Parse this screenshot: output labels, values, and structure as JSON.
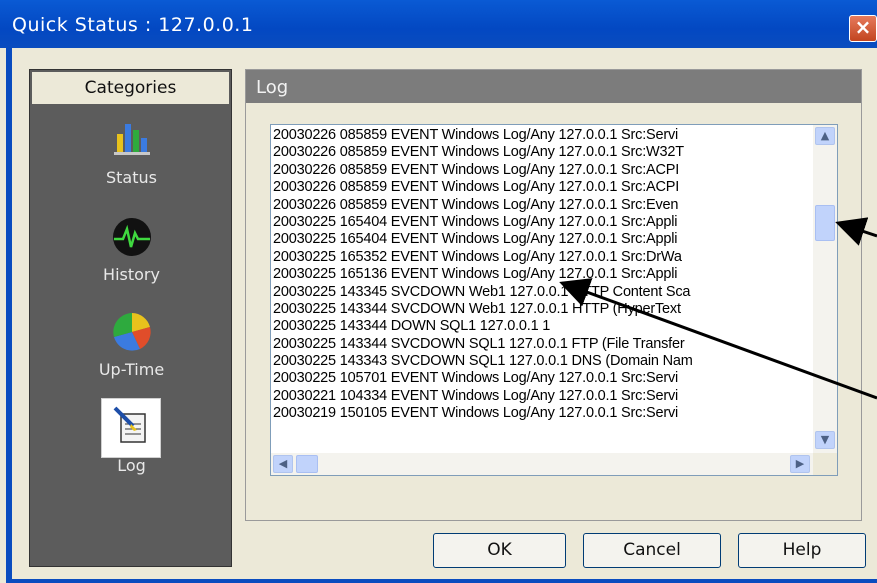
{
  "window": {
    "title": "Quick Status : 127.0.0.1",
    "close_label": "×"
  },
  "categories": {
    "header": "Categories",
    "items": [
      {
        "label": "Status",
        "icon": "bar-chart-icon"
      },
      {
        "label": "History",
        "icon": "heartbeat-icon"
      },
      {
        "label": "Up-Time",
        "icon": "pie-chart-icon"
      },
      {
        "label": "Log",
        "icon": "log-document-icon"
      }
    ]
  },
  "log": {
    "header": "Log",
    "lines": [
      "20030226 085859 EVENT Windows Log/Any 127.0.0.1 Src:Servi",
      "20030226 085859 EVENT Windows Log/Any 127.0.0.1 Src:W32T",
      "20030226 085859 EVENT Windows Log/Any 127.0.0.1 Src:ACPI",
      "20030226 085859 EVENT Windows Log/Any 127.0.0.1 Src:ACPI",
      "20030226 085859 EVENT Windows Log/Any 127.0.0.1 Src:Even",
      "20030225 165404 EVENT Windows Log/Any 127.0.0.1 Src:Appli",
      "20030225 165404 EVENT Windows Log/Any 127.0.0.1 Src:Appli",
      "20030225 165352 EVENT Windows Log/Any 127.0.0.1 Src:DrWa",
      "20030225 165136 EVENT Windows Log/Any 127.0.0.1 Src:Appli",
      "20030225 143345 SVCDOWN Web1 127.0.0.1 HTTP Content Sca",
      "20030225 143344 SVCDOWN Web1 127.0.0.1 HTTP (HyperText",
      "20030225 143344 DOWN SQL1 127.0.0.1 1",
      "20030225 143344 SVCDOWN SQL1 127.0.0.1 FTP (File Transfer",
      "20030225 143343 SVCDOWN SQL1 127.0.0.1 DNS (Domain Nam",
      "20030225 105701 EVENT Windows Log/Any 127.0.0.1 Src:Servi",
      "20030221 104334 EVENT Windows Log/Any 127.0.0.1 Src:Servi",
      "20030219 150105 EVENT Windows Log/Any 127.0.0.1 Src:Servi"
    ]
  },
  "scrollbar": {
    "up": "▲",
    "down": "▼",
    "left": "◀",
    "right": "▶"
  },
  "buttons": {
    "ok": "OK",
    "cancel": "Cancel",
    "help": "Help"
  },
  "colors": {
    "titlebar": "#0a4cbf",
    "category_panel": "#5c5c5c",
    "log_header": "#7c7c7c",
    "dialog_bg": "#ece9d8"
  }
}
